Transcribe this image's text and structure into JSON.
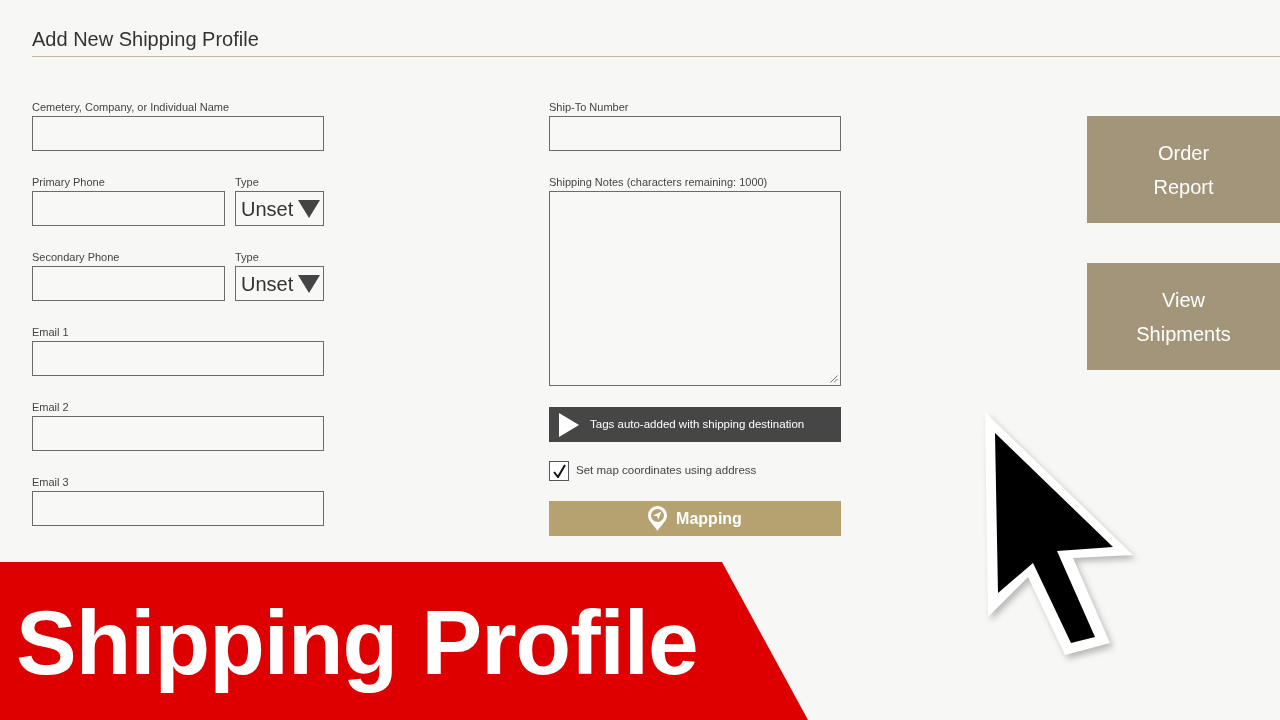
{
  "header": {
    "title": "Add New Shipping Profile"
  },
  "left_fields": [
    {
      "kind": "text",
      "label": "Cemetery, Company, or Individual Name"
    },
    {
      "kind": "phone",
      "label": "Primary Phone",
      "type_label": "Type",
      "type_value": "Unset"
    },
    {
      "kind": "phone",
      "label": "Secondary Phone",
      "type_label": "Type",
      "type_value": "Unset"
    },
    {
      "kind": "text",
      "label": "Email 1"
    },
    {
      "kind": "text",
      "label": "Email 2"
    },
    {
      "kind": "text",
      "label": "Email 3"
    }
  ],
  "right_fields": {
    "ship_to": {
      "label": "Ship-To Number"
    },
    "notes": {
      "label": "Shipping Notes (characters remaining: 1000)"
    },
    "tags_bar": {
      "text": "Tags auto-added with shipping destination"
    },
    "map_checkbox": {
      "label": "Set map coordinates using address",
      "checked": true
    },
    "mapping_button": {
      "label": "Mapping"
    }
  },
  "side_buttons": [
    {
      "label": "Order Report"
    },
    {
      "label": "View Shipments"
    }
  ],
  "banner": {
    "text": "Shipping Profile"
  }
}
